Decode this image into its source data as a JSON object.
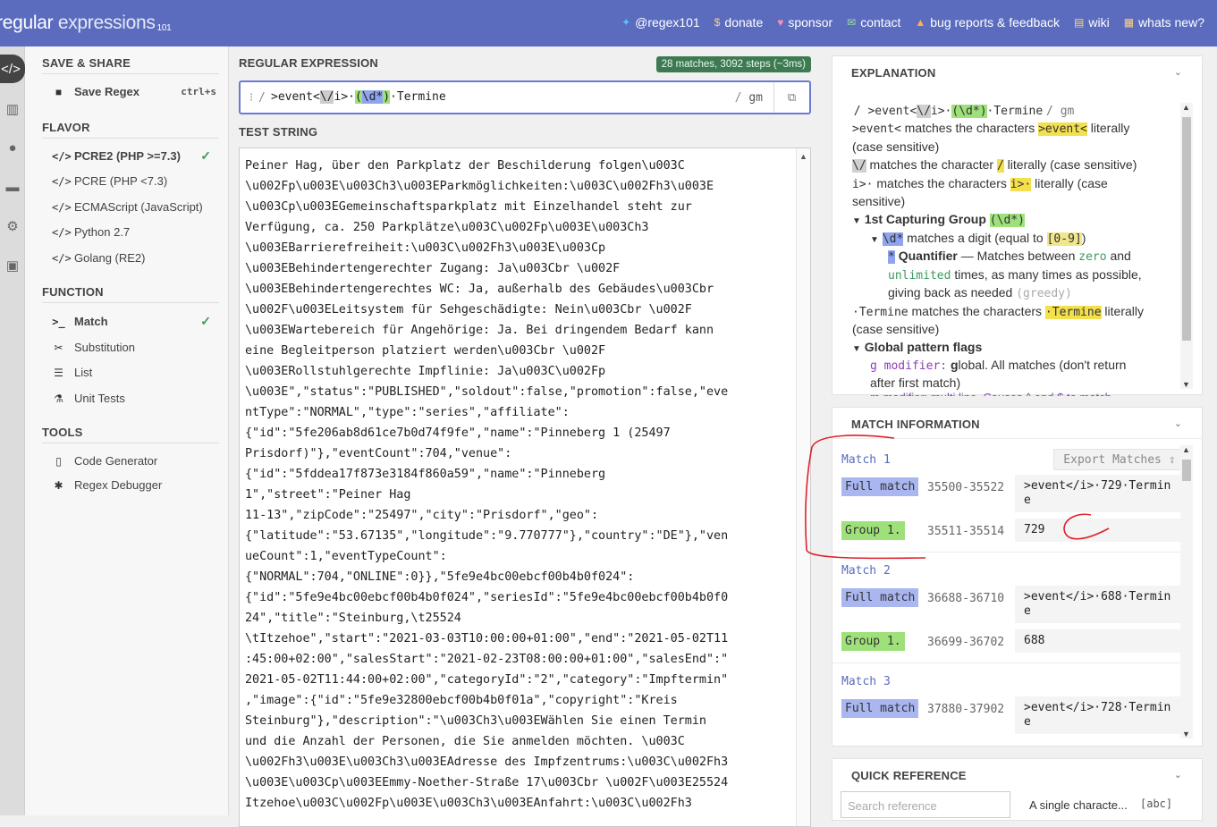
{
  "header": {
    "logo_main": "regular",
    "logo_light": " expressions",
    "logo_sub": "101",
    "nav": [
      {
        "label": "@regex101",
        "icon": "twitter-icon"
      },
      {
        "label": "donate",
        "icon": "dollar-icon"
      },
      {
        "label": "sponsor",
        "icon": "heart-icon"
      },
      {
        "label": "contact",
        "icon": "mail-icon"
      },
      {
        "label": "bug reports & feedback",
        "icon": "warning-icon"
      },
      {
        "label": "wiki",
        "icon": "chat-icon"
      },
      {
        "label": "whats new?",
        "icon": "news-icon"
      }
    ]
  },
  "sidebar": {
    "save_share_title": "SAVE & SHARE",
    "save_regex_label": "Save Regex",
    "save_regex_shortcut": "ctrl+s",
    "flavor_title": "FLAVOR",
    "flavors": [
      "PCRE2 (PHP >=7.3)",
      "PCRE (PHP <7.3)",
      "ECMAScript (JavaScript)",
      "Python 2.7",
      "Golang (RE2)"
    ],
    "function_title": "FUNCTION",
    "functions": [
      "Match",
      "Substitution",
      "List",
      "Unit Tests"
    ],
    "tools_title": "TOOLS",
    "tools": [
      "Code Generator",
      "Regex Debugger"
    ]
  },
  "regex": {
    "title": "REGULAR EXPRESSION",
    "status_badge": "28 matches, 3092 steps (~3ms)",
    "delimiter_open": "/",
    "delimiter_close": "/",
    "flags": "gm",
    "expr_p1": ">event<",
    "expr_p2": "\\/",
    "expr_p3": "i>·",
    "expr_p4": "(",
    "expr_p5": "\\d*",
    "expr_p6": ")",
    "expr_p7": "·Termine"
  },
  "test_string": {
    "title": "TEST STRING",
    "lines": [
      "Peiner Hag, über den Parkplatz der Beschilderung folgen\\u003C",
      "\\u002Fp\\u003E\\u003Ch3\\u003EParkmöglichkeiten:\\u003C\\u002Fh3\\u003E",
      "\\u003Cp\\u003EGemeinschaftsparkplatz mit Einzelhandel steht zur",
      "Verfügung, ca. 250 Parkplätze\\u003C\\u002Fp\\u003E\\u003Ch3",
      "\\u003EBarrierefreiheit:\\u003C\\u002Fh3\\u003E\\u003Cp",
      "\\u003EBehindertengerechter Zugang: Ja\\u003Cbr \\u002F",
      "\\u003EBehindertengerechtes WC: Ja, außerhalb des Gebäudes\\u003Cbr",
      "\\u002F\\u003ELeitsystem für Sehgeschädigte: Nein\\u003Cbr \\u002F",
      "\\u003EWartebereich für Angehörige: Ja. Bei dringendem Bedarf kann",
      "eine Begleitperson platziert werden\\u003Cbr \\u002F",
      "\\u003ERollstuhlgerechte Impflinie: Ja\\u003C\\u002Fp",
      "\\u003E\",\"status\":\"PUBLISHED\",\"soldout\":false,\"promotion\":false,\"eve",
      "ntType\":\"NORMAL\",\"type\":\"series\",\"affiliate\":",
      "{\"id\":\"5fe206ab8d61ce7b0d74f9fe\",\"name\":\"Pinneberg 1 (25497",
      "Prisdorf)\"},\"eventCount\":704,\"venue\":",
      "{\"id\":\"5fddea17f873e3184f860a59\",\"name\":\"Pinneberg",
      "1\",\"street\":\"Peiner Hag",
      "11-13\",\"zipCode\":\"25497\",\"city\":\"Prisdorf\",\"geo\":",
      "{\"latitude\":\"53.67135\",\"longitude\":\"9.770777\"},\"country\":\"DE\"},\"ven",
      "ueCount\":1,\"eventTypeCount\":",
      "{\"NORMAL\":704,\"ONLINE\":0}},\"5fe9e4bc00ebcf00b4b0f024\":",
      "{\"id\":\"5fe9e4bc00ebcf00b4b0f024\",\"seriesId\":\"5fe9e4bc00ebcf00b4b0f0",
      "24\",\"title\":\"Steinburg,\\t25524",
      "\\tItzehoe\",\"start\":\"2021-03-03T10:00:00+01:00\",\"end\":\"2021-05-02T11",
      ":45:00+02:00\",\"salesStart\":\"2021-02-23T08:00:00+01:00\",\"salesEnd\":\"",
      "2021-05-02T11:44:00+02:00\",\"categoryId\":\"2\",\"category\":\"Impftermin\"",
      ",\"image\":{\"id\":\"5fe9e32800ebcf00b4b0f01a\",\"copyright\":\"Kreis",
      "Steinburg\"},\"description\":\"\\u003Ch3\\u003EWählen Sie einen Termin",
      "und die Anzahl der Personen, die Sie anmelden möchten. \\u003C",
      "\\u002Fh3\\u003E\\u003Ch3\\u003EAdresse des Impfzentrums:\\u003C\\u002Fh3",
      "\\u003E\\u003Cp\\u003EEmmy-Noether-Straße 17\\u003Cbr \\u002F\\u003E25524",
      "Itzehoe\\u003C\\u002Fp\\u003E\\u003Ch3\\u003EAnfahrt:\\u003C\\u002Fh3"
    ]
  },
  "explanation": {
    "title": "EXPLANATION",
    "root_a": "/ >event<",
    "root_b": "\\/",
    "root_c": "i>·",
    "root_d": "(\\d*)",
    "root_e": "·Termine",
    "root_f": "/ gm",
    "l1_code": ">event<",
    "l1_text": " matches the characters ",
    "l1_hl": ">event<",
    "l1_text2": " literally",
    "l1_cont": "(case sensitive)",
    "l2_code": "\\/",
    "l2_text": " matches the character ",
    "l2_hl": "/",
    "l2_text2": " literally (case sensitive)",
    "l3_code": "i>·",
    "l3_text": " matches the characters ",
    "l3_hl": "i>·",
    "l3_text2": " literally (case",
    "l3_cont": "sensitive)",
    "g1_label": "1st Capturing Group ",
    "g1_code": "(\\d*)",
    "d_code": "\\d*",
    "d_text": " matches a digit (equal to ",
    "d_hl": "[0-9]",
    "d_text2": ")",
    "q_code": "*",
    "q_label": " Quantifier",
    "q_text": " — Matches between ",
    "q_zero": "zero",
    "q_and": " and",
    "q_unlimited": "unlimited",
    "q_text2": " times, as many times as possible,",
    "q_text3": "giving back as needed ",
    "q_greedy": "(greedy)",
    "t_code": "·Termine",
    "t_text": " matches the characters ",
    "t_hl": "·Termine",
    "t_text2": " literally",
    "t_cont": "(case sensitive)",
    "flags_label": "Global pattern flags",
    "g_mod": "g modifier:",
    "g_text_a": " g",
    "g_text_b": "lobal. All matches (don't return",
    "g_cont": "after first match)",
    "m_partial": "m modifier: multi line. Causes ^ and $ to match"
  },
  "match_info": {
    "title": "MATCH INFORMATION",
    "export_label": "Export Matches",
    "matches": [
      {
        "title": "Match 1",
        "full_label": "Full match",
        "full_range": "35500-35522",
        "full_value": ">event</i>·729·Termine",
        "group_label": "Group 1.",
        "group_range": "35511-35514",
        "group_value": "729"
      },
      {
        "title": "Match 2",
        "full_label": "Full match",
        "full_range": "36688-36710",
        "full_value": ">event</i>·688·Termine",
        "group_label": "Group 1.",
        "group_range": "36699-36702",
        "group_value": "688"
      },
      {
        "title": "Match 3",
        "full_label": "Full match",
        "full_range": "37880-37902",
        "full_value": ">event</i>·728·Termine"
      }
    ]
  },
  "quick_reference": {
    "title": "QUICK REFERENCE",
    "search_placeholder": "Search reference",
    "first_item": "A single characte...",
    "first_code": "[abc]"
  }
}
